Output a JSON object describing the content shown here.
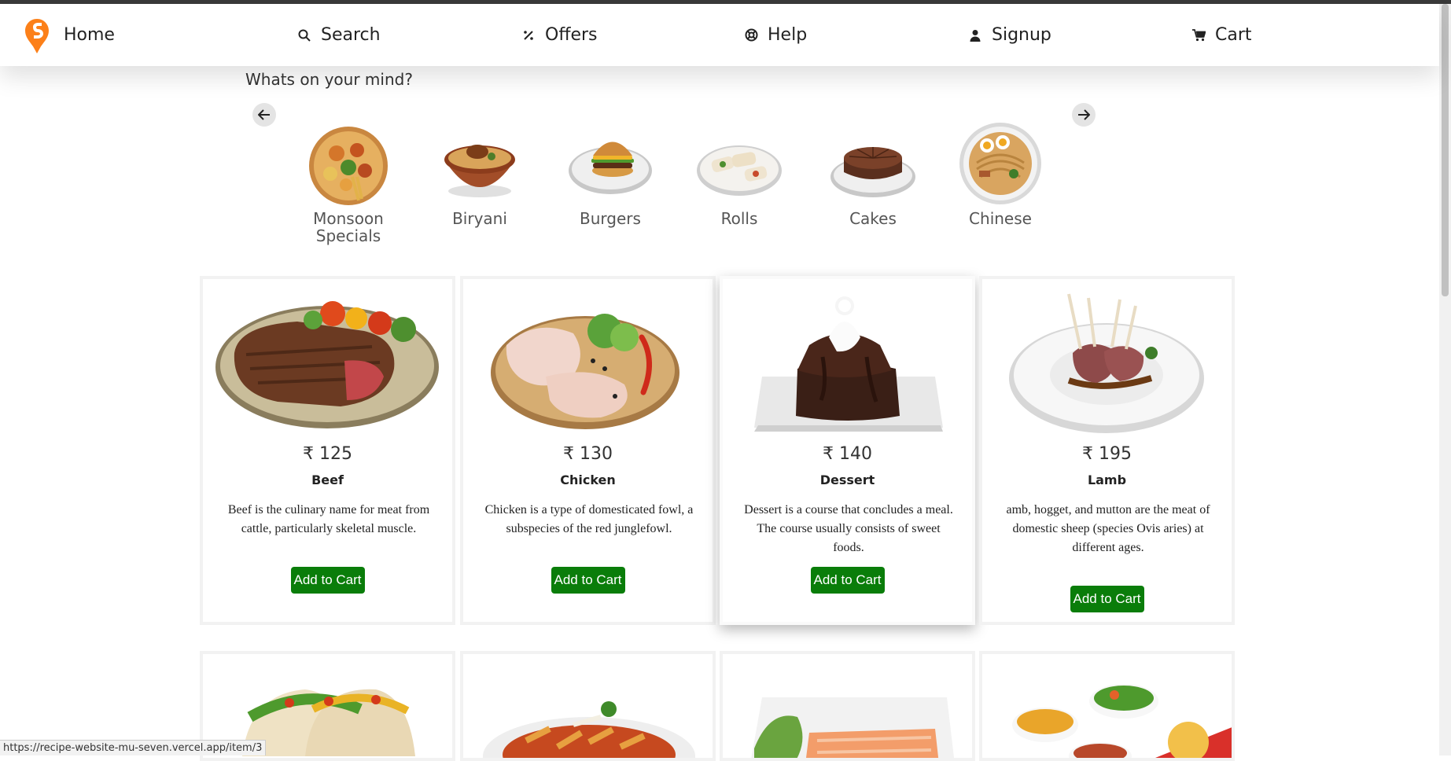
{
  "nav": {
    "home": "Home",
    "search": "Search",
    "offers": "Offers",
    "help": "Help",
    "signup": "Signup",
    "cart": "Cart"
  },
  "categories_title": "Whats on your mind?",
  "categories": [
    {
      "label": "Monsoon Specials"
    },
    {
      "label": "Biryani"
    },
    {
      "label": "Burgers"
    },
    {
      "label": "Rolls"
    },
    {
      "label": "Cakes"
    },
    {
      "label": "Chinese"
    }
  ],
  "currency_symbol": "₹",
  "items": [
    {
      "price": "125",
      "name": "Beef",
      "description": "Beef is the culinary name for meat from cattle, particularly skeletal muscle.",
      "button": "Add to Cart"
    },
    {
      "price": "130",
      "name": "Chicken",
      "description": "Chicken is a type of domesticated fowl, a subspecies of the red junglefowl.",
      "button": "Add to Cart"
    },
    {
      "price": "140",
      "name": "Dessert",
      "description": "Dessert is a course that concludes a meal. The course usually consists of sweet foods.",
      "button": "Add to Cart"
    },
    {
      "price": "195",
      "name": "Lamb",
      "description": "amb, hogget, and mutton are the meat of domestic sheep (species Ovis aries) at different ages.",
      "button": "Add to Cart"
    }
  ],
  "status_url": "https://recipe-website-mu-seven.vercel.app/item/3",
  "colors": {
    "brand": "#fc8019",
    "button": "#0a7d0a"
  }
}
